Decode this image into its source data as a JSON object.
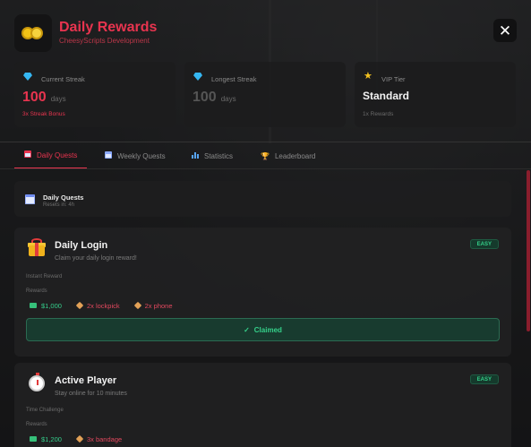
{
  "header": {
    "title": "Daily Rewards",
    "subtitle": "CheesyScripts Development",
    "close_icon": "close-icon"
  },
  "stats": {
    "current_streak": {
      "label": "Current Streak",
      "value": "100",
      "unit": "days",
      "bonus": "3x Streak Bonus",
      "icon": "diamond-icon"
    },
    "longest_streak": {
      "label": "Longest Streak",
      "value": "100",
      "unit": "days",
      "icon": "diamond-icon"
    },
    "vip_tier": {
      "label": "VIP Tier",
      "value": "Standard",
      "sub": "1x Rewards",
      "icon": "star-icon"
    }
  },
  "tabs": [
    {
      "label": "Daily Quests",
      "active": true
    },
    {
      "label": "Weekly Quests",
      "active": false
    },
    {
      "label": "Statistics",
      "active": false
    },
    {
      "label": "Leaderboard",
      "active": false
    }
  ],
  "section": {
    "title": "Daily Quests",
    "reset": "Resets in: 4h"
  },
  "quests": [
    {
      "title": "Daily Login",
      "description": "Claim your daily login reward!",
      "difficulty": "EASY",
      "type": "Instant Reward",
      "rewards_label": "Rewards",
      "rewards": [
        {
          "kind": "cash",
          "text": "$1,000"
        },
        {
          "kind": "item",
          "text": "2x lockpick"
        },
        {
          "kind": "item",
          "text": "2x phone"
        }
      ],
      "status": "Claimed"
    },
    {
      "title": "Active Player",
      "description": "Stay online for 10 minutes",
      "difficulty": "EASY",
      "type": "Time Challenge",
      "rewards_label": "Rewards",
      "rewards": [
        {
          "kind": "cash",
          "text": "$1,200"
        },
        {
          "kind": "item",
          "text": "3x bandage"
        }
      ]
    }
  ],
  "colors": {
    "accent": "#e8344f",
    "success": "#35d08a",
    "background": "#1b1b1c"
  }
}
